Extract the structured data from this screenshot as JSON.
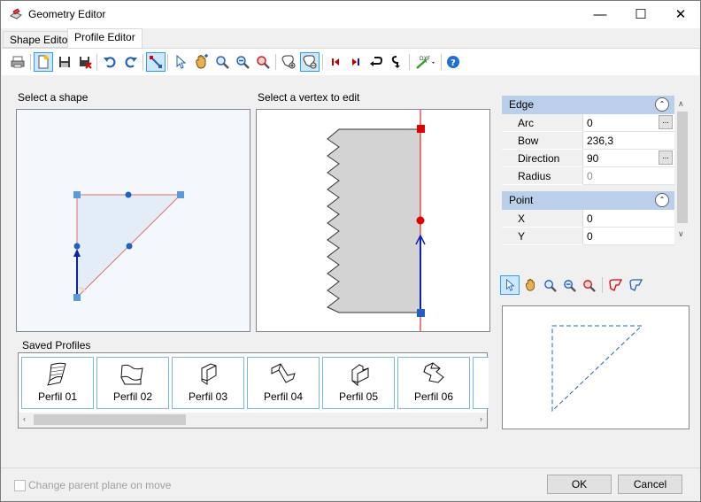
{
  "window": {
    "title": "Geometry Editor",
    "minimize": "—",
    "maximize": "☐",
    "close": "✕"
  },
  "tabs": [
    {
      "label": "Shape Editor"
    },
    {
      "label": "Profile Editor"
    }
  ],
  "labels": {
    "select_shape": "Select a shape",
    "select_vertex": "Select a vertex to edit",
    "saved_profiles": "Saved Profiles"
  },
  "properties": {
    "edge": {
      "title": "Edge",
      "rows": [
        {
          "key": "Arc",
          "value": "0"
        },
        {
          "key": "Bow",
          "value": "236,3"
        },
        {
          "key": "Direction",
          "value": "90"
        },
        {
          "key": "Radius",
          "value": "0"
        }
      ]
    },
    "point": {
      "title": "Point",
      "rows": [
        {
          "key": "X",
          "value": "0"
        },
        {
          "key": "Y",
          "value": "0"
        }
      ]
    },
    "ellipsis": "..."
  },
  "profiles": [
    {
      "label": "Perfil 01"
    },
    {
      "label": "Perfil 02"
    },
    {
      "label": "Perfil 03"
    },
    {
      "label": "Perfil 04"
    },
    {
      "label": "Perfil 05"
    },
    {
      "label": "Perfil 06"
    }
  ],
  "footer": {
    "checkbox_label": "Change parent plane on move",
    "ok": "OK",
    "cancel": "Cancel"
  },
  "colors": {
    "accent": "#3399ff",
    "vertex_blue": "#5b9bd5",
    "vertex_red": "#e00000",
    "edge_red": "#e00000",
    "prop_header": "#bad0ea"
  },
  "icons": [
    "print-icon",
    "new-icon",
    "save-icon",
    "delete-icon",
    "undo-icon",
    "redo-icon",
    "edit-shape-icon",
    "pointer-icon",
    "pan-icon",
    "zoom-in-icon",
    "zoom-out-icon",
    "zoom-extents-icon",
    "add-vertex-icon",
    "remove-vertex-icon",
    "first-icon",
    "last-icon",
    "rotate-icon",
    "flip-icon",
    "dxf-import-icon",
    "help-icon"
  ]
}
